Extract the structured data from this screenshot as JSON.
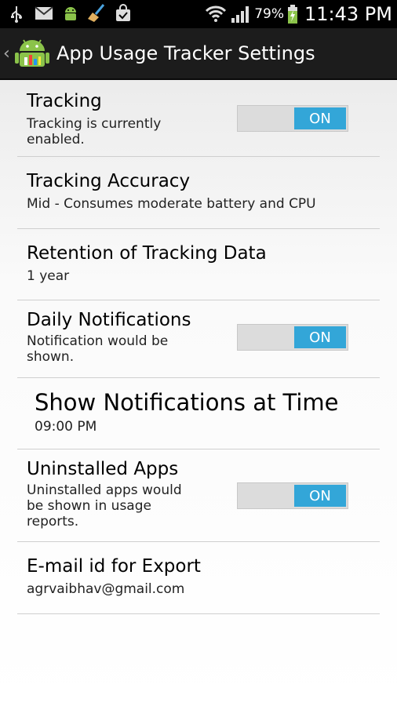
{
  "status_bar": {
    "battery_percent": "79%",
    "time": "11:43 PM",
    "left_icons": [
      "usb-icon",
      "gmail-icon",
      "android-icon",
      "broom-icon",
      "shopping-bag-icon"
    ],
    "right_icons": [
      "wifi-icon",
      "signal-icon",
      "battery-charging-icon"
    ]
  },
  "action_bar": {
    "title": "App Usage Tracker Settings",
    "back_icon": "chevron-left-icon",
    "app_icon": "android-chart-icon"
  },
  "settings": {
    "tracking": {
      "title": "Tracking",
      "summary_line1": "Tracking is currently",
      "summary_line2": "enabled.",
      "toggle": "ON"
    },
    "accuracy": {
      "title": "Tracking Accuracy",
      "summary": "Mid - Consumes moderate battery and CPU"
    },
    "retention": {
      "title": "Retention of Tracking Data",
      "summary": "1 year"
    },
    "daily_notifications": {
      "title": "Daily Notifications",
      "summary_line1": "Notification would be",
      "summary_line2": "shown.",
      "toggle": "ON"
    },
    "notification_time": {
      "title": "Show Notifications at Time",
      "summary": "09:00 PM"
    },
    "uninstalled_apps": {
      "title": "Uninstalled Apps",
      "summary_line1": "Uninstalled apps would",
      "summary_line2": "be shown in usage",
      "summary_line3": "reports.",
      "toggle": "ON"
    },
    "email": {
      "title": "E-mail id for Export",
      "summary": "agrvaibhav@gmail.com"
    }
  },
  "colors": {
    "accent": "#33a6d8",
    "actionbar": "#1c1c1c",
    "statusbar": "#000000"
  }
}
